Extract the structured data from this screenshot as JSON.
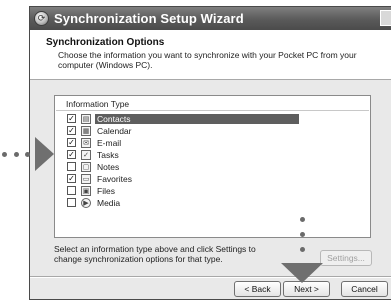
{
  "window": {
    "title": "Synchronization Setup Wizard"
  },
  "header": {
    "title": "Synchronization Options",
    "description": "Choose the information you want to synchronize with your Pocket PC from your computer (Windows PC)."
  },
  "list": {
    "column_header": "Information Type",
    "items": [
      {
        "label": "Contacts",
        "checked": true,
        "selected": true,
        "icon": "contacts-icon",
        "glyph": "▤"
      },
      {
        "label": "Calendar",
        "checked": true,
        "selected": false,
        "icon": "calendar-icon",
        "glyph": "▦"
      },
      {
        "label": "E-mail",
        "checked": true,
        "selected": false,
        "icon": "email-icon",
        "glyph": "✉"
      },
      {
        "label": "Tasks",
        "checked": true,
        "selected": false,
        "icon": "tasks-icon",
        "glyph": "✓"
      },
      {
        "label": "Notes",
        "checked": false,
        "selected": false,
        "icon": "notes-icon",
        "glyph": "▢"
      },
      {
        "label": "Favorites",
        "checked": true,
        "selected": false,
        "icon": "favorites-icon",
        "glyph": "▭"
      },
      {
        "label": "Files",
        "checked": false,
        "selected": false,
        "icon": "files-icon",
        "glyph": "▣"
      },
      {
        "label": "Media",
        "checked": false,
        "selected": false,
        "icon": "media-icon",
        "glyph": "▶"
      }
    ]
  },
  "bottom": {
    "description": "Select an information type above and click Settings to change synchronization options for that type.",
    "settings_label": "Settings..."
  },
  "buttons": {
    "back": "< Back",
    "next": "Next >",
    "cancel": "Cancel"
  },
  "colors": {
    "title_bar": "#5a5a5a",
    "selection": "#5e5e5e",
    "annotation": "#6f6f6f"
  }
}
